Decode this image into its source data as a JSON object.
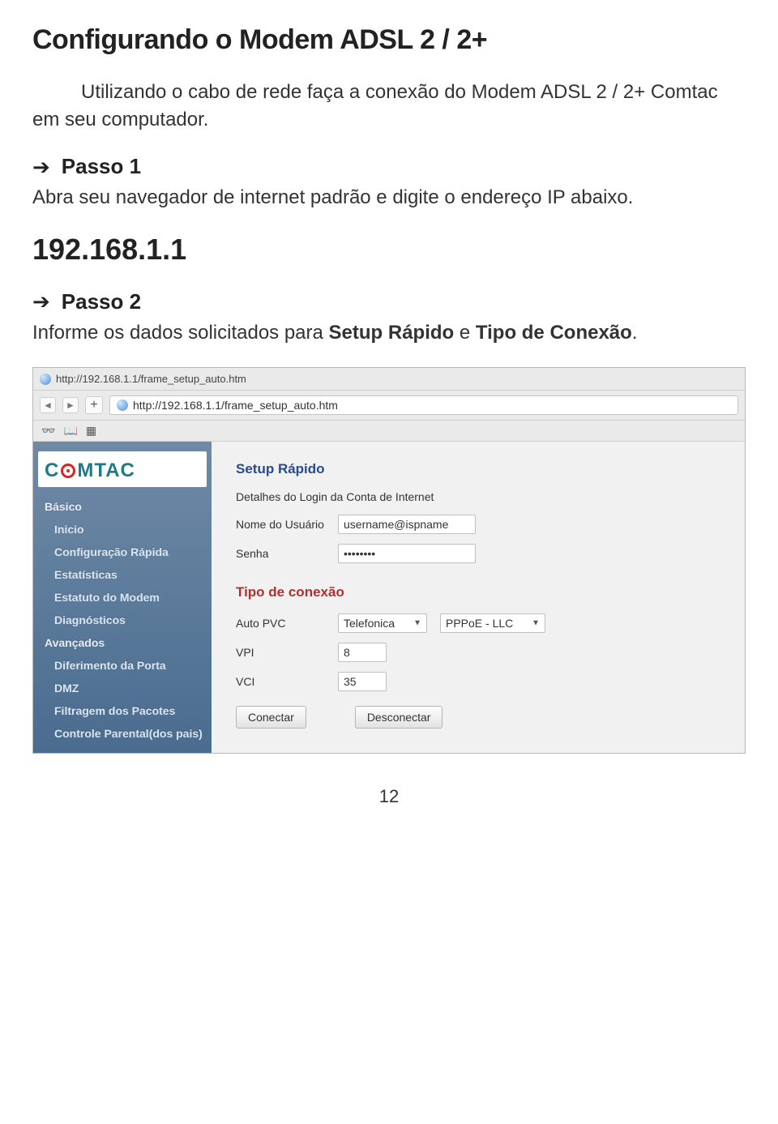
{
  "doc": {
    "title": "Configurando o Modem ADSL 2 / 2+",
    "intro": "Utilizando o cabo de rede faça a conexão do Modem ADSL 2 / 2+ Comtac em seu computador.",
    "step1_label": "Passo 1",
    "step1_desc": "Abra seu navegador de internet padrão e digite o endereço IP abaixo.",
    "ip": "192.168.1.1",
    "step2_label": "Passo 2",
    "step2_desc_pre": "Informe os dados solicitados para ",
    "step2_b1": "Setup Rápido",
    "step2_mid": " e ",
    "step2_b2": "Tipo de Conexão",
    "step2_after": ".",
    "page_number": "12"
  },
  "browser": {
    "tab_url": "http://192.168.1.1/frame_setup_auto.htm",
    "address_url": "http://192.168.1.1/frame_setup_auto.htm"
  },
  "logo": {
    "pre": "C",
    "post": "MTAC"
  },
  "nav": [
    {
      "label": "Básico",
      "sub": false
    },
    {
      "label": "Inicio",
      "sub": true
    },
    {
      "label": "Configuração Rápida",
      "sub": true
    },
    {
      "label": "Estatísticas",
      "sub": true
    },
    {
      "label": "Estatuto do Modem",
      "sub": true
    },
    {
      "label": "Diagnósticos",
      "sub": true
    },
    {
      "label": "Avançados",
      "sub": false
    },
    {
      "label": "Diferimento da Porta",
      "sub": true
    },
    {
      "label": "DMZ",
      "sub": true
    },
    {
      "label": "Filtragem dos Pacotes",
      "sub": true
    },
    {
      "label": "Controle Parental(dos pais)",
      "sub": true
    }
  ],
  "form": {
    "section1": "Setup Rápido",
    "section1_desc": "Detalhes do Login da Conta de Internet",
    "username_label": "Nome do Usuário",
    "username_value": "username@ispname",
    "password_label": "Senha",
    "password_value": "••••••••",
    "section2": "Tipo de conexão",
    "autopvc_label": "Auto PVC",
    "autopvc_select1": "Telefonica",
    "autopvc_select2": "PPPoE - LLC",
    "vpi_label": "VPI",
    "vpi_value": "8",
    "vci_label": "VCI",
    "vci_value": "35",
    "btn_connect": "Conectar",
    "btn_disconnect": "Desconectar"
  }
}
